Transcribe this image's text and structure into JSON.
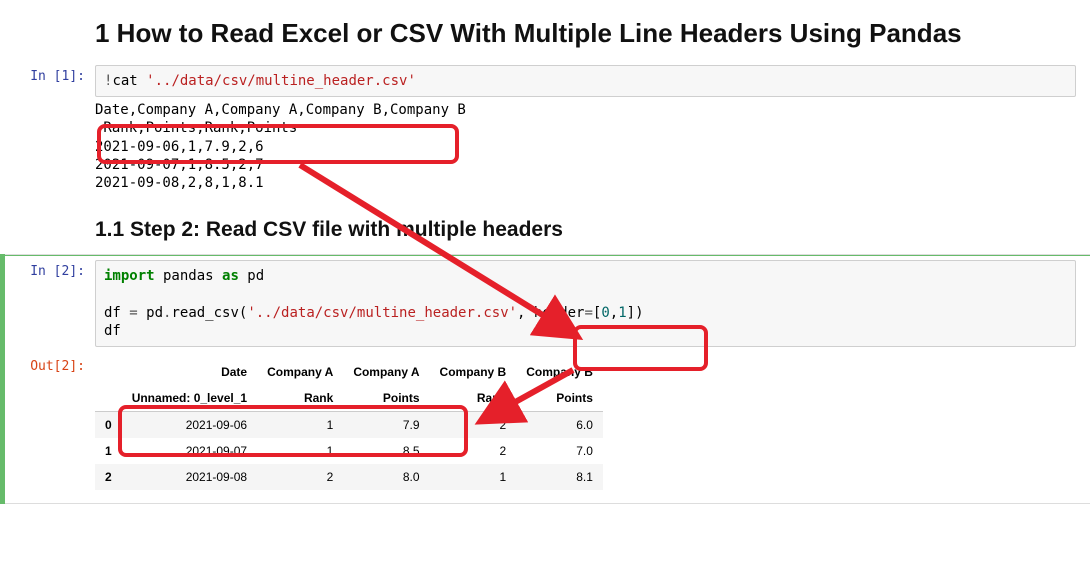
{
  "h1": "1  How to Read Excel or CSV With Multiple Line Headers Using Pandas",
  "h2": "1.1  Step 2: Read CSV file with multiple headers",
  "prompts": {
    "in1": "In [1]:",
    "in2": "In [2]:",
    "out2": "Out[2]:"
  },
  "cell1": {
    "bang": "!",
    "cmd": "cat ",
    "path": "'../data/csv/multine_header.csv'",
    "output_lines": [
      "Date,Company A,Company A,Company B,Company B",
      ",Rank,Points,Rank,Points",
      "2021-09-06,1,7.9,2,6",
      "2021-09-07,1,8.5,2,7",
      "2021-09-08,2,8,1,8.1"
    ]
  },
  "cell2": {
    "kw_import": "import",
    "mod": " pandas ",
    "kw_as": "as",
    "alias": " pd",
    "line2a": "df ",
    "eq": "=",
    "line2b": " pd",
    "dot": ".",
    "fn": "read_csv(",
    "arg_str": "'../data/csv/multine_header.csv'",
    "comma": ", ",
    "kw_header": "header",
    "eq2": "=",
    "br_open": "[",
    "n0": "0",
    "c2": ",",
    "n1": "1",
    "br_close": "])",
    "line3": "df"
  },
  "chart_data": {
    "type": "table",
    "header_row1": [
      "",
      "Date",
      "Company A",
      "Company A",
      "Company B",
      "Company B"
    ],
    "header_row2": [
      "",
      "Unnamed: 0_level_1",
      "Rank",
      "Points",
      "Rank",
      "Points"
    ],
    "rows": [
      [
        "0",
        "2021-09-06",
        "1",
        "7.9",
        "2",
        "6.0"
      ],
      [
        "1",
        "2021-09-07",
        "1",
        "8.5",
        "2",
        "7.0"
      ],
      [
        "2",
        "2021-09-08",
        "2",
        "8.0",
        "1",
        "8.1"
      ]
    ]
  }
}
